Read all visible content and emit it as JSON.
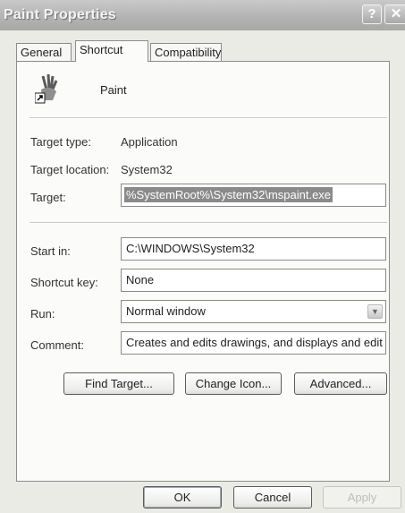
{
  "window": {
    "title": "Paint Properties"
  },
  "titlebar": {
    "help_glyph": "?",
    "close_glyph": "✕"
  },
  "tabs": [
    {
      "label": "General",
      "active": false
    },
    {
      "label": "Shortcut",
      "active": true
    },
    {
      "label": "Compatibility",
      "active": false
    }
  ],
  "shortcut": {
    "app_name": "Paint",
    "target_type_label": "Target type:",
    "target_type_value": "Application",
    "target_location_label": "Target location:",
    "target_location_value": "System32",
    "target_label": "Target:",
    "target_value": "%SystemRoot%\\System32\\mspaint.exe",
    "start_in_label": "Start in:",
    "start_in_value": "C:\\WINDOWS\\System32",
    "shortcut_key_label": "Shortcut key:",
    "shortcut_key_value": "None",
    "run_label": "Run:",
    "run_value": "Normal window",
    "comment_label": "Comment:",
    "comment_value": "Creates and edits drawings, and displays and edit"
  },
  "actions": {
    "find_target": "Find Target...",
    "change_icon": "Change Icon...",
    "advanced": "Advanced..."
  },
  "footer": {
    "ok": "OK",
    "cancel": "Cancel",
    "apply": "Apply"
  }
}
